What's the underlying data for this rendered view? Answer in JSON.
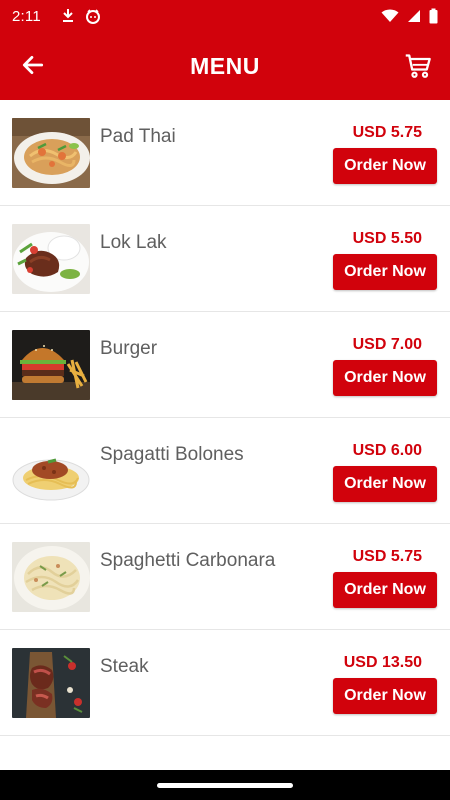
{
  "status_bar": {
    "time": "2:11",
    "icons": [
      "download-notification-icon",
      "face-notification-icon",
      "wifi-icon",
      "signal-icon",
      "battery-icon"
    ]
  },
  "app_bar": {
    "title": "MENU",
    "back_icon": "arrow-left-icon",
    "cart_icon": "shopping-cart-icon",
    "background_color": "#d1020c"
  },
  "menu": {
    "items": [
      {
        "name": "Pad Thai",
        "price": "USD 5.75",
        "button": "Order Now",
        "image": "pad-thai-dish"
      },
      {
        "name": "Lok Lak",
        "price": "USD 5.50",
        "button": "Order Now",
        "image": "lok-lak-dish"
      },
      {
        "name": "Burger",
        "price": "USD 7.00",
        "button": "Order Now",
        "image": "burger-dish"
      },
      {
        "name": "Spagatti Bolones",
        "price": "USD 6.00",
        "button": "Order Now",
        "image": "spaghetti-bolognese-dish"
      },
      {
        "name": "Spaghetti Carbonara",
        "price": "USD 5.75",
        "button": "Order Now",
        "image": "spaghetti-carbonara-dish"
      },
      {
        "name": "Steak",
        "price": "USD 13.50",
        "button": "Order Now",
        "image": "steak-dish"
      }
    ]
  },
  "colors": {
    "accent": "#d1020c",
    "item_text": "#5f5f5f",
    "divider": "#e6e6e6"
  }
}
